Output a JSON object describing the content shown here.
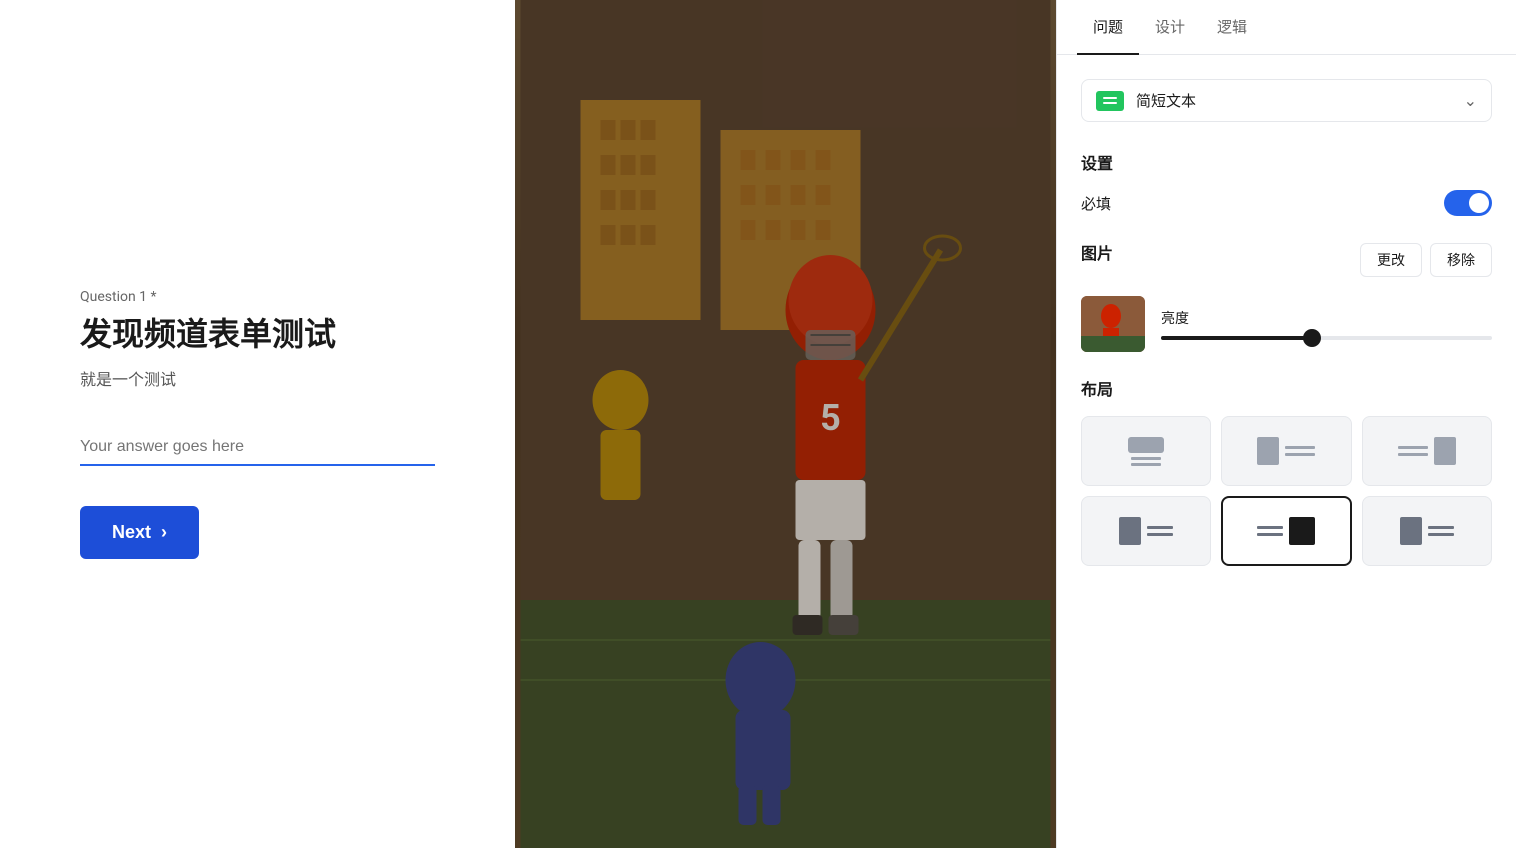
{
  "left": {
    "question_label": "Question 1 *",
    "question_title": "发现频道表单测试",
    "question_subtitle": "就是一个测试",
    "answer_placeholder": "Your answer goes here",
    "next_button": "Next"
  },
  "tabs": [
    {
      "label": "问题",
      "active": true
    },
    {
      "label": "设计",
      "active": false
    },
    {
      "label": "逻辑",
      "active": false
    }
  ],
  "right": {
    "type_label": "简短文本",
    "settings_title": "设置",
    "required_label": "必填",
    "image_section_label": "图片",
    "change_btn": "更改",
    "remove_btn": "移除",
    "brightness_label": "亮度",
    "layout_title": "布局",
    "brightness_value": 45
  }
}
